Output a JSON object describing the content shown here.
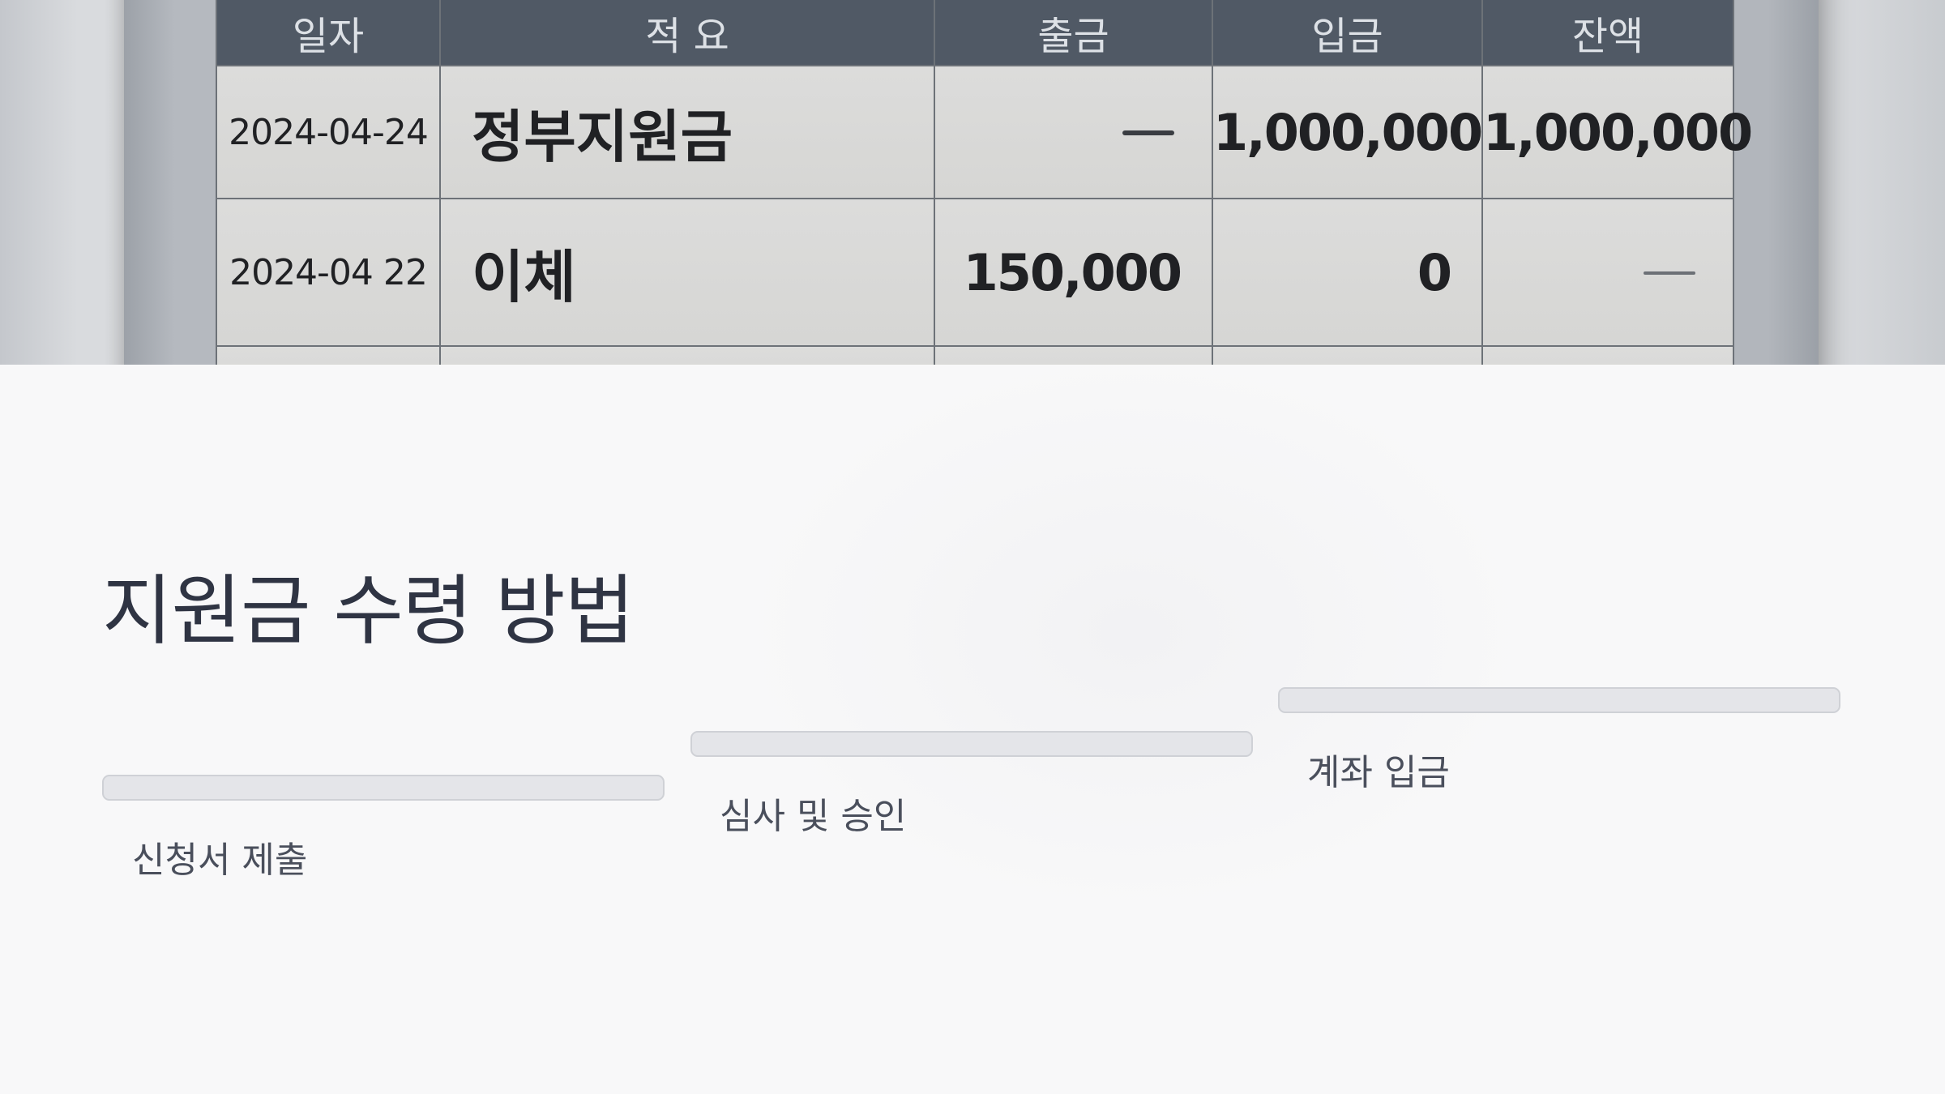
{
  "statement": {
    "headers": [
      "일자",
      "적 요",
      "출금",
      "입금",
      "잔액"
    ],
    "rows": [
      {
        "date": "2024-04-24",
        "desc": "정부지원금",
        "withdrawal": "",
        "deposit": "1,000,000",
        "balance": "1,000,000"
      },
      {
        "date": "2024-04 22",
        "desc": "이체",
        "withdrawal": "150,000",
        "deposit": "0",
        "balance": ""
      }
    ]
  },
  "slide": {
    "title": "지원금 수령 방법",
    "steps": [
      {
        "label": "신청서 제출"
      },
      {
        "label": "심사 및 승인"
      },
      {
        "label": "계좌 입금"
      }
    ]
  }
}
